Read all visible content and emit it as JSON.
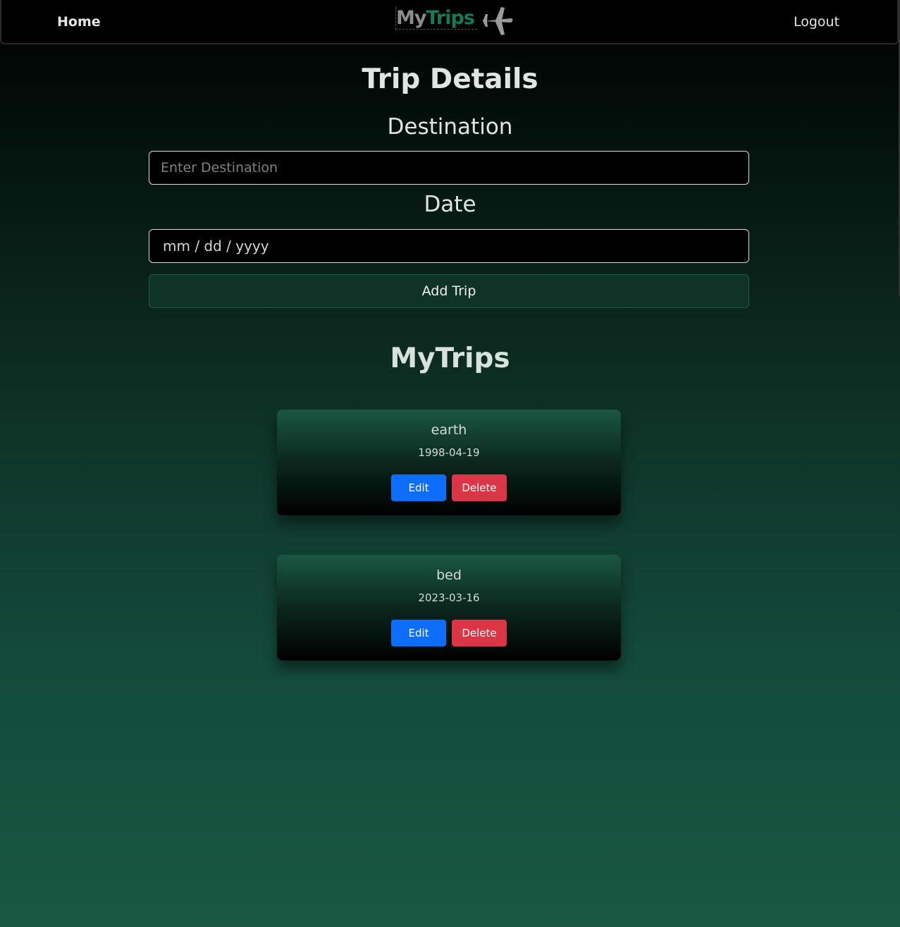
{
  "nav": {
    "home_label": "Home",
    "logout_label": "Logout",
    "logo": {
      "part1": "My",
      "part2": "Trips",
      "icon": "airplane-icon"
    }
  },
  "form": {
    "title": "Trip Details",
    "destination_label": "Destination",
    "destination_placeholder": "Enter Destination",
    "date_label": "Date",
    "date_placeholder": "mm / dd / yyyy",
    "submit_label": "Add Trip"
  },
  "trips": {
    "title": "MyTrips",
    "items": [
      {
        "name": "earth",
        "date": "1998-04-19",
        "edit_label": "Edit",
        "delete_label": "Delete"
      },
      {
        "name": "bed",
        "date": "2023-03-16",
        "edit_label": "Edit",
        "delete_label": "Delete"
      }
    ]
  },
  "colors": {
    "edit": "#0d6efd",
    "delete": "#dc3545",
    "brand_green": "#167a55"
  }
}
